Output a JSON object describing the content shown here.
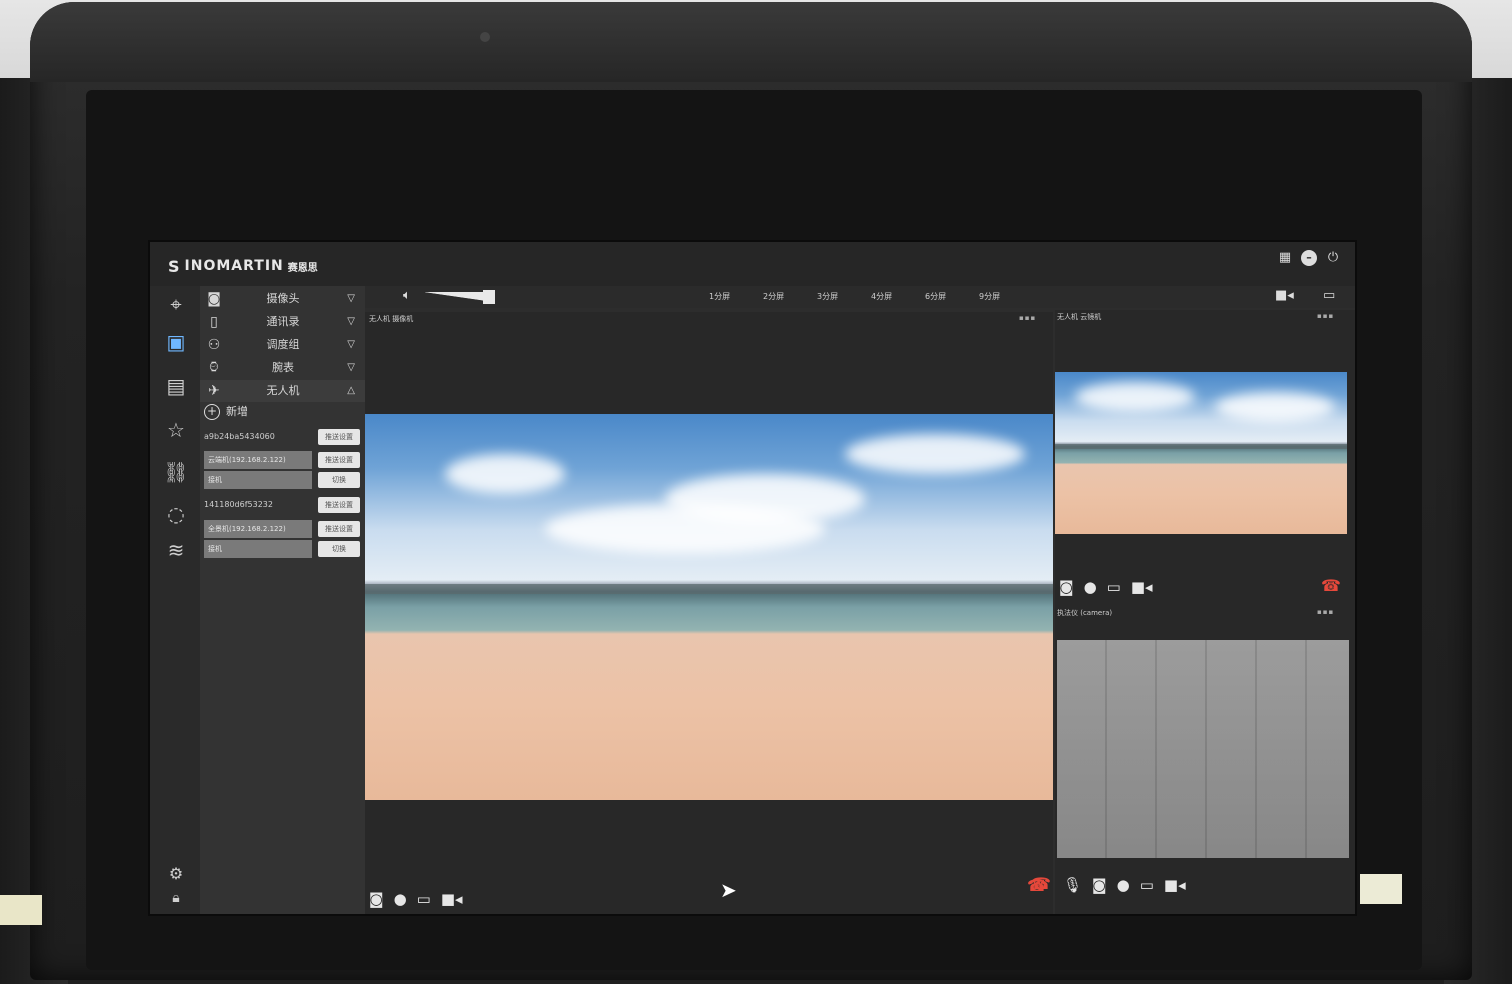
{
  "app": {
    "brand": "INOMARTIN",
    "brand_cn": "赛恩思"
  },
  "top_icons": [
    "grid-icon",
    "minimize-icon",
    "power-icon"
  ],
  "rail": {
    "items": [
      "map-icon",
      "monitor-icon",
      "document-icon",
      "star-icon",
      "link-icon",
      "chat-icon",
      "route-icon"
    ],
    "bottom": [
      "settings-icon",
      "lock-icon"
    ]
  },
  "tree": {
    "groups": [
      {
        "label": "摄像头",
        "icon": "camera-icon",
        "expanded": false
      },
      {
        "label": "通讯录",
        "icon": "contacts-icon",
        "expanded": false
      },
      {
        "label": "调度组",
        "icon": "group-icon",
        "expanded": false
      },
      {
        "label": "腕表",
        "icon": "watch-icon",
        "expanded": false
      },
      {
        "label": "无人机",
        "icon": "drone-icon",
        "expanded": true
      }
    ],
    "add_label": "新增",
    "devices": [
      {
        "id": "a9b24ba5434060",
        "button": "推送设置",
        "ip": "云端机(192.168.2.122)",
        "sub": "接机",
        "sub_button": "切换"
      },
      {
        "id": "141180d6f53232",
        "button": "推送设置",
        "ip": "全景机(192.168.2.122)",
        "sub": "接机",
        "sub_button": "切换"
      }
    ]
  },
  "toolbar": {
    "split_tabs": [
      "1分屏",
      "2分屏",
      "3分屏",
      "4分屏",
      "6分屏",
      "9分屏"
    ],
    "right_icons": [
      "video-camera-icon",
      "screen-share-icon"
    ]
  },
  "panes": {
    "main_title": "无人机 摄像机",
    "right_top_title": "无人机 云镜机",
    "right_bottom_title": "执法仪 (camera)"
  },
  "colors": {
    "accent": "#6fb7ff",
    "hangup": "#e5483b"
  }
}
